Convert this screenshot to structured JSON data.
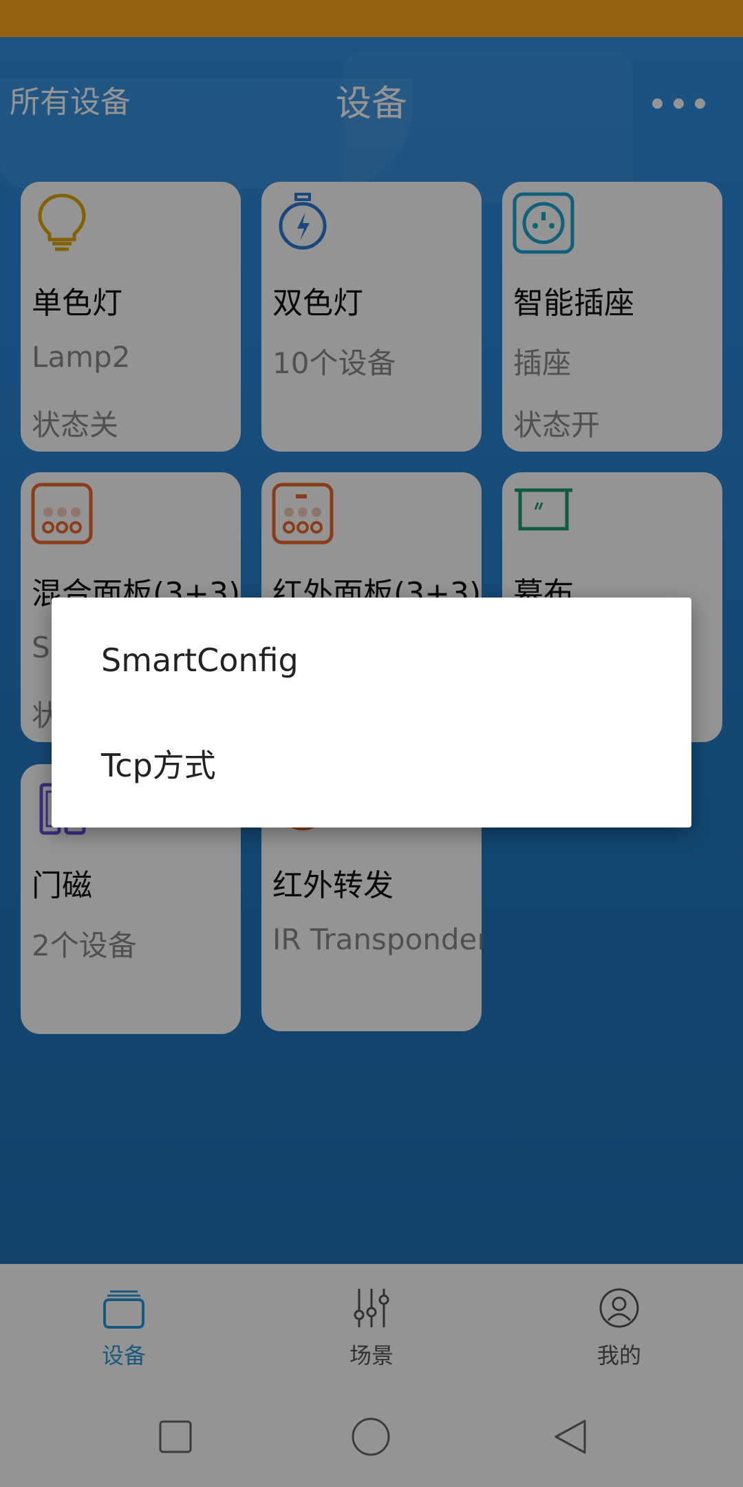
{
  "header": {
    "left_label": "所有设备",
    "title": "设备",
    "more_icon": "more-dots-icon"
  },
  "devices": [
    {
      "name": "单色灯",
      "sub": "Lamp2",
      "status": "状态关",
      "icon": "bulb-icon",
      "color": "#e0a800"
    },
    {
      "name": "双色灯",
      "sub": "10个设备",
      "status": "",
      "icon": "bulb-bolt-icon",
      "color": "#2e7bd8"
    },
    {
      "name": "智能插座",
      "sub": "插座",
      "status": "状态开",
      "icon": "socket-icon",
      "color": "#1aa5d0"
    },
    {
      "name": "混合面板(3+3)",
      "sub": "S",
      "status": "状",
      "icon": "panel-icon",
      "color": "#ee6a2a"
    },
    {
      "name": "红外面板(3+3)",
      "sub": "",
      "status": "",
      "icon": "panel-icon",
      "color": "#ee6a2a"
    },
    {
      "name": "幕布",
      "sub": "",
      "status": "",
      "icon": "screen-icon",
      "color": "#1a9c74"
    },
    {
      "name": "门磁",
      "sub": "2个设备",
      "status": "",
      "icon": "door-sensor-icon",
      "color": "#6a4ee0"
    },
    {
      "name": "红外转发",
      "sub": "IR Transponder",
      "status": "",
      "icon": "ir-icon",
      "color": "#ee6a2a"
    }
  ],
  "bottom_nav": [
    {
      "label": "设备",
      "icon": "device-tab-icon",
      "active": true
    },
    {
      "label": "场景",
      "icon": "sliders-icon",
      "active": false
    },
    {
      "label": "我的",
      "icon": "user-icon",
      "active": false
    }
  ],
  "dialog": {
    "options": [
      "SmartConfig",
      "Tcp方式"
    ]
  },
  "colors": {
    "status_bar": "#ffab22",
    "accent": "#2a9bd8",
    "scrim": "rgba(0,0,0,0.42)"
  }
}
